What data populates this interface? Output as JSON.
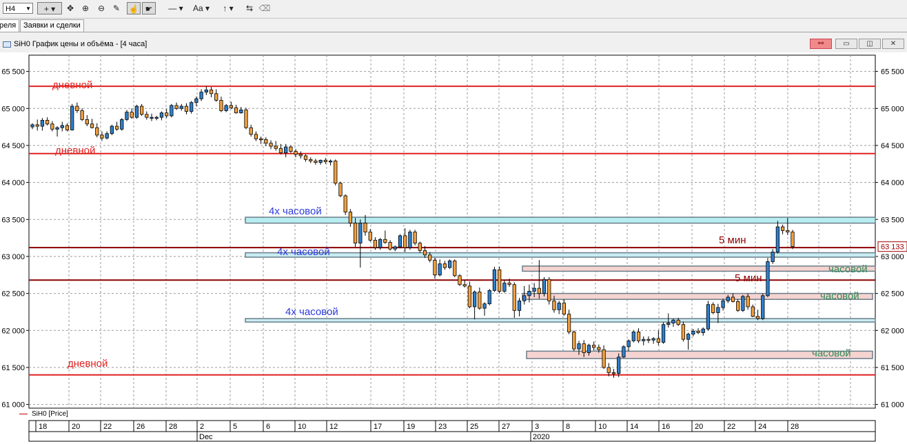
{
  "toolbar": {
    "timeframe": "H4",
    "buttons": [
      "+",
      "✥",
      "⊕",
      "⊖",
      "✎",
      "☝",
      "☛",
      "—",
      "Aa",
      "↑",
      "⇆"
    ]
  },
  "tabs": [
    "реля",
    "Заявки и сделки"
  ],
  "window": {
    "title": "SiH0 График цены и объёма - [4 часа]"
  },
  "chart_data": {
    "type": "candlestick",
    "y_ticks": [
      "65 500",
      "65 000",
      "64 500",
      "64 000",
      "63 500",
      "63 000",
      "62 500",
      "62 000",
      "61 500",
      "61 000"
    ],
    "ylim": [
      60950,
      65720
    ],
    "x_ticks": [
      "18",
      "20",
      "22",
      "26",
      "28",
      "2",
      "5",
      "6",
      "10",
      "12",
      "17",
      "19",
      "23",
      "25",
      "27",
      "3",
      "8",
      "10",
      "14",
      "16",
      "20",
      "22",
      "24",
      "28"
    ],
    "x_month_labels": [
      "Dec",
      "2020"
    ],
    "current_price": "63 133",
    "series_name": "SiH0 [Price]",
    "levels": [
      {
        "price": 65300,
        "label": "дневной",
        "color": "#e02020",
        "kind": "line"
      },
      {
        "price": 64390,
        "label": "дневной",
        "color": "#e02020",
        "kind": "line"
      },
      {
        "price": 61400,
        "label": "дневной",
        "color": "#e02020",
        "kind": "line"
      },
      {
        "price": 63120,
        "label": "5 мин",
        "color": "#8b0000",
        "kind": "line"
      },
      {
        "price": 62680,
        "label": "5 мин",
        "color": "#8b0000",
        "kind": "line"
      }
    ],
    "zones": [
      {
        "low": 63450,
        "high": 63530,
        "label": "4х часовой",
        "fill": "#b7ecf0",
        "text_color": "#2b3adb"
      },
      {
        "low": 62990,
        "high": 63050,
        "label": "4х часовой",
        "fill": "#c9ecf2",
        "text_color": "#2b3adb"
      },
      {
        "low": 62120,
        "high": 62160,
        "label": "4х часовой",
        "fill": "#c9ecf2",
        "text_color": "#2b3adb"
      },
      {
        "low": 62800,
        "high": 62870,
        "label": "часовой",
        "fill": "#f5d3d0",
        "text_color": "#2e8b57"
      },
      {
        "low": 62420,
        "high": 62500,
        "label": "часовой",
        "fill": "#f5d3d0",
        "text_color": "#2e8b57"
      },
      {
        "low": 61620,
        "high": 61720,
        "label": "часовой",
        "fill": "#f5d3d0",
        "text_color": "#2e8b57"
      }
    ],
    "candles": [
      [
        64750,
        64800,
        64720,
        64780
      ],
      [
        64780,
        64850,
        64700,
        64760
      ],
      [
        64760,
        64870,
        64700,
        64840
      ],
      [
        64840,
        64880,
        64770,
        64790
      ],
      [
        64790,
        64830,
        64690,
        64720
      ],
      [
        64720,
        64760,
        64620,
        64740
      ],
      [
        64740,
        64820,
        64690,
        64770
      ],
      [
        64770,
        64800,
        64690,
        64710
      ],
      [
        64710,
        65060,
        64700,
        65030
      ],
      [
        65030,
        65080,
        64940,
        64970
      ],
      [
        64970,
        65000,
        64830,
        64850
      ],
      [
        64850,
        64910,
        64760,
        64790
      ],
      [
        64790,
        64860,
        64730,
        64740
      ],
      [
        64740,
        64800,
        64610,
        64640
      ],
      [
        64640,
        64690,
        64560,
        64600
      ],
      [
        64600,
        64690,
        64580,
        64660
      ],
      [
        64660,
        64780,
        64640,
        64760
      ],
      [
        64760,
        64820,
        64700,
        64720
      ],
      [
        64720,
        64870,
        64700,
        64850
      ],
      [
        64850,
        64980,
        64830,
        64950
      ],
      [
        64950,
        65000,
        64860,
        64880
      ],
      [
        64880,
        65050,
        64860,
        65030
      ],
      [
        65030,
        65060,
        64900,
        64920
      ],
      [
        64920,
        64960,
        64850,
        64880
      ],
      [
        64880,
        64930,
        64830,
        64880
      ],
      [
        64880,
        64900,
        64840,
        64880
      ],
      [
        64880,
        64960,
        64840,
        64940
      ],
      [
        64940,
        64990,
        64870,
        64900
      ],
      [
        64900,
        65060,
        64880,
        65040
      ],
      [
        65040,
        65080,
        64980,
        65000
      ],
      [
        65000,
        65060,
        64970,
        65030
      ],
      [
        65030,
        65070,
        64920,
        64960
      ],
      [
        64960,
        65100,
        64930,
        65080
      ],
      [
        65080,
        65160,
        65030,
        65130
      ],
      [
        65130,
        65260,
        65100,
        65220
      ],
      [
        65220,
        65300,
        65180,
        65250
      ],
      [
        65250,
        65290,
        65150,
        65200
      ],
      [
        65200,
        65260,
        65090,
        65110
      ],
      [
        65110,
        65160,
        64950,
        64970
      ],
      [
        64970,
        65060,
        64950,
        65040
      ],
      [
        65040,
        65090,
        64990,
        65010
      ],
      [
        65010,
        65050,
        64930,
        64940
      ],
      [
        64940,
        65020,
        64930,
        64980
      ],
      [
        64980,
        65010,
        64720,
        64740
      ],
      [
        64740,
        64780,
        64620,
        64650
      ],
      [
        64650,
        64690,
        64560,
        64590
      ],
      [
        64590,
        64620,
        64520,
        64580
      ],
      [
        64580,
        64610,
        64490,
        64530
      ],
      [
        64530,
        64570,
        64450,
        64490
      ],
      [
        64490,
        64560,
        64430,
        64460
      ],
      [
        64460,
        64520,
        64380,
        64400
      ],
      [
        64400,
        64520,
        64340,
        64480
      ],
      [
        64480,
        64500,
        64400,
        64420
      ],
      [
        64420,
        64450,
        64340,
        64380
      ],
      [
        64380,
        64420,
        64320,
        64360
      ],
      [
        64360,
        64380,
        64280,
        64310
      ],
      [
        64310,
        64340,
        64260,
        64290
      ],
      [
        64290,
        64320,
        64240,
        64270
      ],
      [
        64270,
        64310,
        64240,
        64300
      ],
      [
        64300,
        64330,
        64250,
        64280
      ],
      [
        64280,
        64310,
        64230,
        64290
      ],
      [
        64290,
        64310,
        63960,
        63990
      ],
      [
        63990,
        64010,
        63800,
        63820
      ],
      [
        63820,
        63840,
        63560,
        63600
      ],
      [
        63600,
        63640,
        63400,
        63450
      ],
      [
        63450,
        63520,
        63130,
        63180
      ],
      [
        63180,
        63500,
        62850,
        63450
      ],
      [
        63450,
        63560,
        63280,
        63330
      ],
      [
        63330,
        63370,
        63200,
        63220
      ],
      [
        63220,
        63260,
        63090,
        63120
      ],
      [
        63120,
        63250,
        63090,
        63230
      ],
      [
        63230,
        63350,
        63170,
        63190
      ],
      [
        63190,
        63220,
        63080,
        63100
      ],
      [
        63100,
        63150,
        63070,
        63130
      ],
      [
        63130,
        63300,
        63110,
        63280
      ],
      [
        63280,
        63380,
        63060,
        63120
      ],
      [
        63120,
        63360,
        63090,
        63330
      ],
      [
        63330,
        63360,
        63150,
        63180
      ],
      [
        63180,
        63200,
        63050,
        63080
      ],
      [
        63080,
        63140,
        62980,
        63020
      ],
      [
        63020,
        63060,
        62920,
        62950
      ],
      [
        62950,
        62980,
        62700,
        62750
      ],
      [
        62750,
        62960,
        62730,
        62900
      ],
      [
        62900,
        62940,
        62820,
        62850
      ],
      [
        62850,
        62960,
        62830,
        62940
      ],
      [
        62940,
        62960,
        62720,
        62740
      ],
      [
        62740,
        62760,
        62600,
        62620
      ],
      [
        62620,
        62680,
        62580,
        62600
      ],
      [
        62600,
        62660,
        62300,
        62320
      ],
      [
        62320,
        62540,
        62150,
        62520
      ],
      [
        62520,
        62580,
        62280,
        62300
      ],
      [
        62300,
        62380,
        62200,
        62360
      ],
      [
        62360,
        62560,
        62340,
        62540
      ],
      [
        62540,
        62860,
        62520,
        62820
      ],
      [
        62820,
        62860,
        62500,
        62530
      ],
      [
        62530,
        62680,
        62510,
        62640
      ],
      [
        62640,
        62700,
        62590,
        62620
      ],
      [
        62620,
        62650,
        62170,
        62270
      ],
      [
        62270,
        62440,
        62190,
        62400
      ],
      [
        62400,
        62600,
        62350,
        62470
      ],
      [
        62470,
        62620,
        62380,
        62530
      ],
      [
        62530,
        62640,
        62450,
        62570
      ],
      [
        62570,
        62950,
        62430,
        62500
      ],
      [
        62500,
        62720,
        62460,
        62690
      ],
      [
        62690,
        62720,
        62350,
        62400
      ],
      [
        62400,
        62470,
        62240,
        62280
      ],
      [
        62280,
        62400,
        62220,
        62370
      ],
      [
        62370,
        62420,
        62200,
        62220
      ],
      [
        62220,
        62280,
        61950,
        61980
      ],
      [
        61980,
        62000,
        61720,
        61750
      ],
      [
        61750,
        61860,
        61670,
        61820
      ],
      [
        61820,
        61870,
        61640,
        61700
      ],
      [
        61700,
        61820,
        61660,
        61800
      ],
      [
        61800,
        61850,
        61730,
        61770
      ],
      [
        61770,
        61810,
        61700,
        61740
      ],
      [
        61740,
        61800,
        61480,
        61500
      ],
      [
        61500,
        61560,
        61380,
        61430
      ],
      [
        61430,
        61480,
        61360,
        61420
      ],
      [
        61420,
        61690,
        61370,
        61640
      ],
      [
        61640,
        61800,
        61630,
        61780
      ],
      [
        61780,
        61880,
        61720,
        61860
      ],
      [
        61860,
        62000,
        61840,
        61980
      ],
      [
        61980,
        62030,
        61830,
        61860
      ],
      [
        61860,
        61920,
        61800,
        61880
      ],
      [
        61880,
        61920,
        61830,
        61870
      ],
      [
        61870,
        61910,
        61820,
        61890
      ],
      [
        61890,
        62000,
        61800,
        61840
      ],
      [
        61840,
        62110,
        61820,
        62080
      ],
      [
        62080,
        62230,
        62040,
        62100
      ],
      [
        62100,
        62160,
        62050,
        62140
      ],
      [
        62140,
        62170,
        62060,
        62080
      ],
      [
        62080,
        62120,
        61850,
        61880
      ],
      [
        61880,
        61970,
        61740,
        61950
      ],
      [
        61950,
        62020,
        61920,
        61990
      ],
      [
        61990,
        62030,
        61950,
        61970
      ],
      [
        61970,
        62040,
        61930,
        62020
      ],
      [
        62020,
        62400,
        62000,
        62350
      ],
      [
        62350,
        62380,
        62220,
        62240
      ],
      [
        62240,
        62360,
        62100,
        62310
      ],
      [
        62310,
        62430,
        62270,
        62400
      ],
      [
        62400,
        62480,
        62370,
        62450
      ],
      [
        62450,
        62500,
        62380,
        62390
      ],
      [
        62390,
        62420,
        62250,
        62270
      ],
      [
        62270,
        62480,
        62250,
        62460
      ],
      [
        62460,
        62500,
        62280,
        62320
      ],
      [
        62320,
        62350,
        62180,
        62190
      ],
      [
        62190,
        62280,
        62140,
        62160
      ],
      [
        62160,
        62500,
        62140,
        62470
      ],
      [
        62470,
        62980,
        62450,
        62930
      ],
      [
        62930,
        63100,
        62900,
        63060
      ],
      [
        63060,
        63480,
        63040,
        63400
      ],
      [
        63400,
        63430,
        63300,
        63350
      ],
      [
        63350,
        63520,
        63290,
        63330
      ],
      [
        63330,
        63360,
        63100,
        63133
      ]
    ]
  }
}
